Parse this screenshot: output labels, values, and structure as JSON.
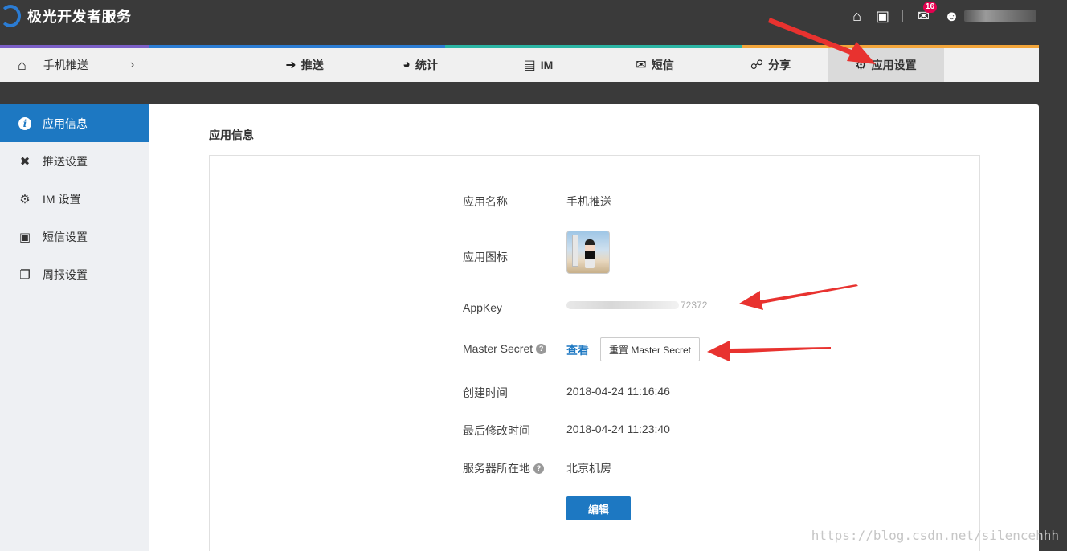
{
  "brand": {
    "name": "极光开发者服务"
  },
  "topbar": {
    "message_count": "16"
  },
  "breadcrumb": {
    "app_name": "手机推送",
    "chevron": "›"
  },
  "nav_tabs": [
    {
      "label": "推送",
      "icon": "sign-in-icon"
    },
    {
      "label": "统计",
      "icon": "chart-icon"
    },
    {
      "label": "IM",
      "icon": "chat-icon"
    },
    {
      "label": "短信",
      "icon": "sms-icon"
    },
    {
      "label": "分享",
      "icon": "share-icon"
    },
    {
      "label": "应用设置",
      "icon": "gear-icon",
      "active": true
    }
  ],
  "nav_colors": [
    "#7b5fc7",
    "#2b7cd3",
    "#2bb5a4",
    "#2bb5a4",
    "#f2a53a",
    "#f2a53a"
  ],
  "sidebar": {
    "items": [
      {
        "label": "应用信息",
        "icon": "info-icon",
        "active": true
      },
      {
        "label": "推送设置",
        "icon": "tools-icon"
      },
      {
        "label": "IM 设置",
        "icon": "gear-icon"
      },
      {
        "label": "短信设置",
        "icon": "sms-settings-icon"
      },
      {
        "label": "周报设置",
        "icon": "copy-icon"
      }
    ]
  },
  "section": {
    "title": "应用信息"
  },
  "fields": {
    "app_name": {
      "label": "应用名称",
      "value": "手机推送"
    },
    "app_icon": {
      "label": "应用图标"
    },
    "appkey": {
      "label": "AppKey",
      "visible_tail": "72372"
    },
    "master_secret": {
      "label": "Master Secret",
      "view_link": "查看",
      "reset_button": "重置 Master Secret"
    },
    "created": {
      "label": "创建时间",
      "value": "2018-04-24 11:16:46"
    },
    "modified": {
      "label": "最后修改时间",
      "value": "2018-04-24 11:23:40"
    },
    "server": {
      "label": "服务器所在地",
      "value": "北京机房"
    }
  },
  "actions": {
    "edit_label": "编辑"
  },
  "watermark": "https://blog.csdn.net/silencehhh",
  "colors": {
    "accent": "#1d78c2",
    "annotation": "#e8322f"
  }
}
